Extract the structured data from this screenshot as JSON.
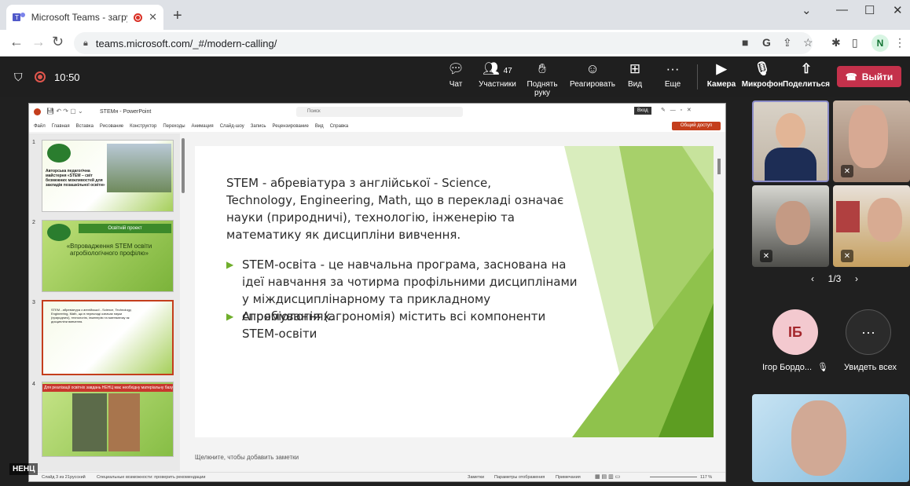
{
  "browser": {
    "tab_title": "Microsoft Teams - загружае",
    "url": "teams.microsoft.com/_#/modern-calling/",
    "profile_initial": "N"
  },
  "meeting": {
    "time": "10:50",
    "participant_count": "47",
    "chat_label": "Чат",
    "participants_label": "Участники",
    "raise_hand_label": "Поднять руку",
    "react_label": "Реагировать",
    "view_label": "Вид",
    "more_label": "Еще",
    "camera_label": "Камера",
    "mic_label": "Микрофон",
    "share_label": "Поделиться",
    "leave_label": "Выйти"
  },
  "ppt": {
    "title": "STEMн - PowerPoint",
    "search_placeholder": "Поиск",
    "user": "Вход",
    "share_btn": "Общий доступ",
    "menu": [
      "Файл",
      "Главная",
      "Вставка",
      "Рисование",
      "Конструктор",
      "Переходы",
      "Анимация",
      "Слайд-шоу",
      "Запись",
      "Рецензирование",
      "Вид",
      "Справка"
    ],
    "thumbs": [
      {
        "num": "1",
        "text": "Авторська педагогічна майстерня «STEM – світ безмежних можливостей для закладів позашкільної освіти»"
      },
      {
        "num": "2",
        "text": "Освітній проект",
        "text2": "«Впровадження STEM освіти агробіологічного профілю»"
      },
      {
        "num": "3",
        "text": "STEM - абревіатура з англійської - Science, Technology, Engineering, Math, що в перекладі означає науки (природничі), технологію, інженерію та математику як дисципліни вивчення."
      },
      {
        "num": "4",
        "text": "Для реалізації освітніх завдань НЕНЦ має необхідну матеріальну базу"
      }
    ],
    "notes": "Щелкните, чтобы добавить заметки",
    "status_left": "Слайд 3 из 21",
    "status_lang": "русский",
    "status_access": "Специальные возможности: проверить рекомендации",
    "status_notes": "Заметки",
    "status_display": "Параметры отображения",
    "status_comments": "Примечания",
    "zoom": "117 %"
  },
  "slide": {
    "intro": "STEM - абревіатура з англійської - Science, Technology, Engineering, Math, що в перекладі означає науки (природничі), технологію, інженерію та математику як дисципліни вивчення.",
    "bullet1": "STEM-освіта - це навчальна програма, заснована на ідеї навчання за чотирма профільними дисциплінами у міждисциплінарному та прикладному спрямуваннях.",
    "bullet2": "Агробіологія (агрономія) містить всі компоненти STEM-освіти"
  },
  "participants": {
    "pager": "1/3",
    "ib_initials": "ІБ",
    "ib_name": "Ігор Бордо...",
    "see_all": "Увидеть всех"
  },
  "watermark": "НЕНЦ"
}
